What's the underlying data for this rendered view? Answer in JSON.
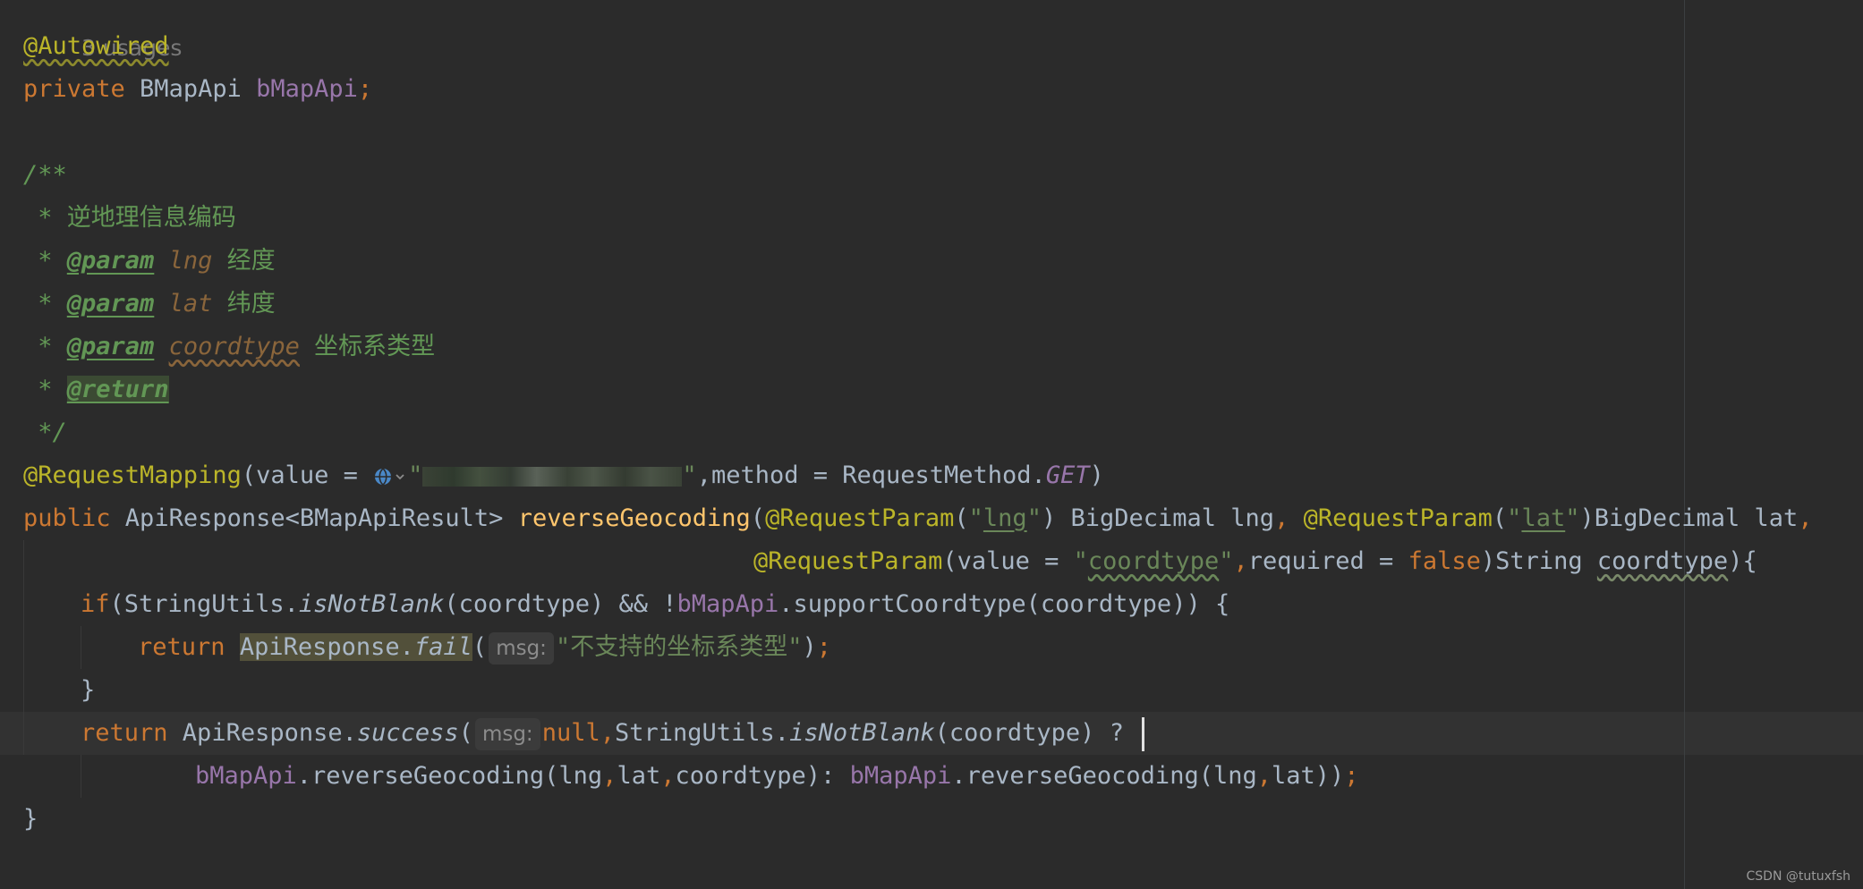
{
  "hint": {
    "usages": "3 usages"
  },
  "code": {
    "annotation_autowired": "@Autowired",
    "kw_private": "private",
    "type_bmapapi": " BMapApi ",
    "field_bmapapi": "bMapApi",
    "semicolon": ";",
    "doc_open": "/**",
    "doc_star": " * ",
    "doc_desc": "逆地理信息编码",
    "doc_param_tag": "@param",
    "doc_param_lng": "lng",
    "doc_lng_desc": " 经度",
    "doc_param_lat": "lat",
    "doc_lat_desc": " 纬度",
    "doc_param_coordtype": "coordtype",
    "doc_coordtype_desc": " 坐标系类型",
    "doc_return_tag": "@return",
    "doc_close": " */",
    "ann_request_mapping": "@RequestMapping",
    "rm_value_open": "(value = ",
    "quote": "\"",
    "rm_method": ",method = RequestMethod.",
    "get": "GET",
    "close_paren": ")",
    "kw_public": "public",
    "return_type": " ApiResponse<BMapApiResult> ",
    "method_name": "reverseGeocoding",
    "open_paren": "(",
    "ann_request_param": "@RequestParam",
    "str_lng": "lng",
    "param_lng": ") BigDecimal lng",
    "comma_space": ", ",
    "str_lat": "lat",
    "param_lat": ")BigDecimal lat",
    "comma": ",",
    "rp_value_open": "(value = ",
    "str_coordtype": "coordtype",
    "required": "required = ",
    "kw_false": "false",
    "param_coordtype_type": ")String ",
    "param_coordtype": "coordtype",
    "brace_open": "){",
    "kw_if": "if",
    "if_open": "(StringUtils.",
    "is_not_blank": "isNotBlank",
    "if_mid": "(coordtype) && !",
    "support_call": ".supportCoordtype(coordtype)) {",
    "kw_return": "return",
    "api_response_fail_cls": "ApiResponse.",
    "fail": "fail",
    "inlay_msg": "msg:",
    "str_not_supported": "\"不支持的坐标系类型\"",
    "close_paren_semi": ")",
    "close_brace": "}",
    "api_response_success_cls": " ApiResponse.",
    "success": "success",
    "kw_null": "null",
    "ternary_mid": "StringUtils.",
    "ternary_cond": "(coordtype) ? ",
    "call_with_type": ".reverseGeocoding(lng",
    "lat_coord": "lat",
    "coord_close": "coordtype): ",
    "call_no_type": ".reverseGeocoding(lng",
    "lat_close": "lat))",
    "final_brace": "}"
  },
  "watermark": "CSDN @tutuxfsh",
  "colors": {
    "background": "#2b2b2b",
    "keyword": "#cc7832",
    "annotation": "#bbb529",
    "field": "#9876aa",
    "doc_comment": "#629755",
    "method_decl": "#ffc66d",
    "string": "#6a8759"
  }
}
